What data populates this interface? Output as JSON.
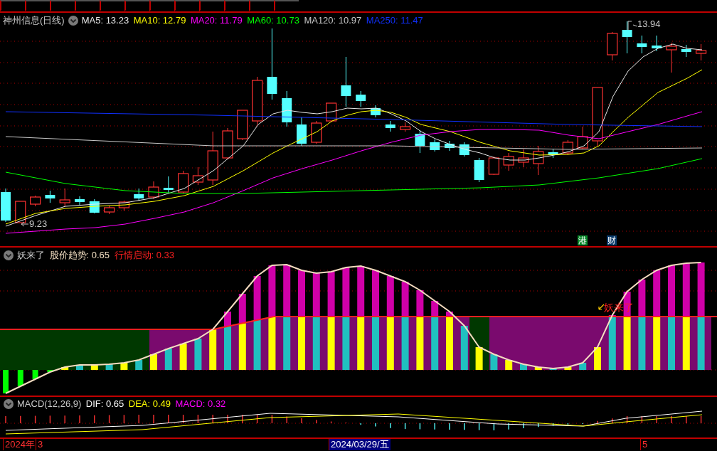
{
  "main_chart": {
    "title": "神州信息(日线)",
    "indicators": [
      {
        "label": "MA5: 13.23",
        "color": "#e8e8e8"
      },
      {
        "label": "MA10: 12.79",
        "color": "#ffff00"
      },
      {
        "label": "MA20: 11.79",
        "color": "#ff00ff"
      },
      {
        "label": "MA60: 10.73",
        "color": "#00ff00"
      },
      {
        "label": "MA120: 10.97",
        "color": "#c8c8c8"
      },
      {
        "label": "MA250: 11.47",
        "color": "#1030ff"
      }
    ],
    "high_label": "13.94",
    "low_label": "9.23",
    "badges": [
      {
        "text": "港",
        "color": "#0a8a2a"
      },
      {
        "text": "财",
        "color": "#0a3a6a"
      }
    ]
  },
  "indicator_panel": {
    "title": "妖来了",
    "values": [
      {
        "label": "股价趋势: 0.65",
        "color": "#f0dcc0"
      },
      {
        "label": "行情启动: 0.33",
        "color": "#ff2020"
      }
    ],
    "signal_label": "妖来了"
  },
  "macd_panel": {
    "title": "MACD(12,26,9)",
    "values": [
      {
        "label": "DIF: 0.65",
        "color": "#ffffff"
      },
      {
        "label": "DEA: 0.49",
        "color": "#ffff00"
      },
      {
        "label": "MACD: 0.32",
        "color": "#ff00ff"
      }
    ]
  },
  "time_axis": {
    "labels": [
      {
        "text": "2024年",
        "selected": false
      },
      {
        "text": "3",
        "selected": false
      },
      {
        "text": "2024/03/29/五",
        "selected": true
      },
      {
        "text": "5",
        "selected": false
      }
    ]
  }
}
